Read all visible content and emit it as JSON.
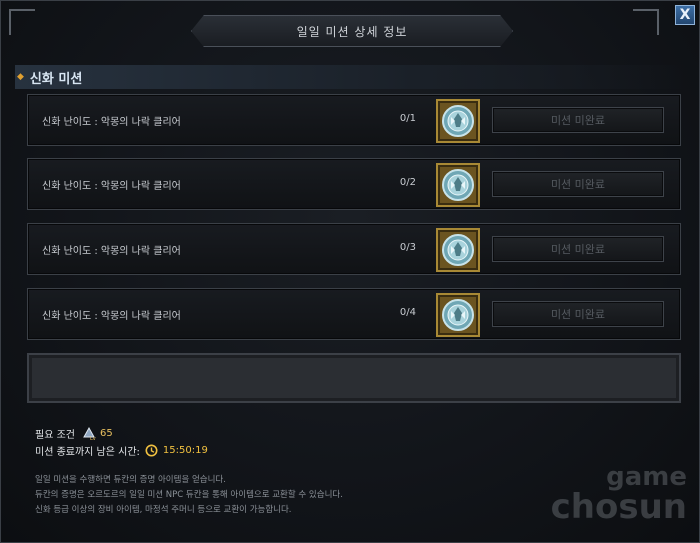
{
  "window": {
    "title": "일일 미션 상세 정보",
    "close_label": "X"
  },
  "section": {
    "title": "신화 미션"
  },
  "missions": [
    {
      "name": "신화 난이도 : 악몽의 나락 클리어",
      "progress": "0/1",
      "status": "미션 미완료",
      "reward_icon": "emblem-icon"
    },
    {
      "name": "신화 난이도 : 악몽의 나락 클리어",
      "progress": "0/2",
      "status": "미션 미완료",
      "reward_icon": "emblem-icon"
    },
    {
      "name": "신화 난이도 : 악몽의 나락 클리어",
      "progress": "0/3",
      "status": "미션 미완료",
      "reward_icon": "emblem-icon"
    },
    {
      "name": "신화 난이도 : 악몽의 나락 클리어",
      "progress": "0/4",
      "status": "미션 미완료",
      "reward_icon": "emblem-icon"
    }
  ],
  "requirements": {
    "label": "필요 조건",
    "level": "65",
    "time_label": "미션 종료까지 남은 시간:",
    "time_value": "15:50:19"
  },
  "info_lines": [
    "일일 미션을 수행하면 듀칸의 증명 아이템을 얻습니다.",
    "듀칸의 증명은 오르도르의 일일 미션 NPC 듀칸을 통해 아이템으로 교환할 수 있습니다.",
    "신화 등급 이상의 장비 아이템, 마정석 주머니 등으로 교환이 가능합니다."
  ],
  "watermark": {
    "line1": "game",
    "line2": "chosun"
  },
  "colors": {
    "accent_gold": "#f0c040",
    "reward_frame": "#a88935",
    "close_button": "#3d6fa6"
  }
}
